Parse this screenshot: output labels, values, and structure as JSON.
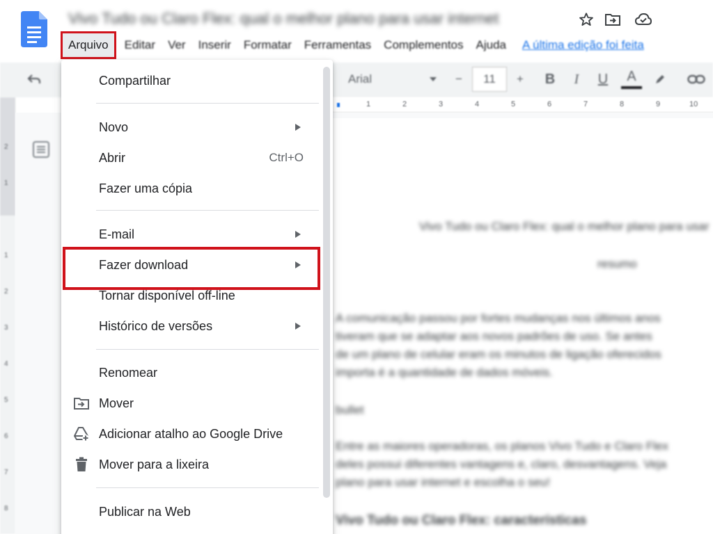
{
  "header": {
    "doc_title": "Vivo Tudo ou Claro Flex: qual o melhor plano para usar internet",
    "icons": [
      "star-icon",
      "move-folder-icon",
      "cloud-status-icon"
    ]
  },
  "menubar": {
    "items": [
      "Arquivo",
      "Editar",
      "Ver",
      "Inserir",
      "Formatar",
      "Ferramentas",
      "Complementos",
      "Ajuda"
    ],
    "last_edit": "A última edição foi feita"
  },
  "toolbar": {
    "font": "Arial",
    "font_size": "11",
    "minus": "−",
    "plus": "+",
    "bold": "B",
    "italic": "I",
    "underline": "U",
    "text_color": "A"
  },
  "ruler": {
    "numbers": [
      "1",
      "2",
      "3",
      "4",
      "5",
      "6",
      "7",
      "8",
      "9",
      "10"
    ],
    "left_numbers": [
      "2",
      "1",
      "1",
      "2",
      "3",
      "4",
      "5",
      "6",
      "7",
      "8"
    ]
  },
  "file_menu": {
    "share": "Compartilhar",
    "new": "Novo",
    "open": "Abrir",
    "open_shortcut": "Ctrl+O",
    "copy": "Fazer uma cópia",
    "email": "E-mail",
    "download": "Fazer download",
    "offline": "Tornar disponível off-line",
    "history": "Histórico de versões",
    "rename": "Renomear",
    "move": "Mover",
    "shortcut": "Adicionar atalho ao Google Drive",
    "trash": "Mover para a lixeira",
    "publish": "Publicar na Web"
  },
  "document": {
    "title_line": "Vivo Tudo ou Claro Flex: qual o melhor plano para usar",
    "subtitle": "resumo",
    "p1_l1": "A comunicação passou por fortes mudanças nos últimos anos",
    "p1_l2": "tiveram que se adaptar aos novos padrões de uso. Se antes",
    "p1_l3": "de um plano de celular eram os minutos de ligação oferecidos",
    "p1_l4": "importa é a quantidade de dados móveis.",
    "bullet": "bullet",
    "p2_l1": "Entre as maiores operadoras, os planos Vivo Tudo e Claro Flex",
    "p2_l2": "deles possui diferentes vantagens e, claro, desvantagens. Veja",
    "p2_l3": "plano para usar internet e escolha o seu!",
    "heading": "Vivo Tudo ou Claro Flex: características"
  },
  "colors": {
    "accent_red": "#d0121b",
    "docs_blue": "#4285f4",
    "link_blue": "#1a73e8"
  }
}
